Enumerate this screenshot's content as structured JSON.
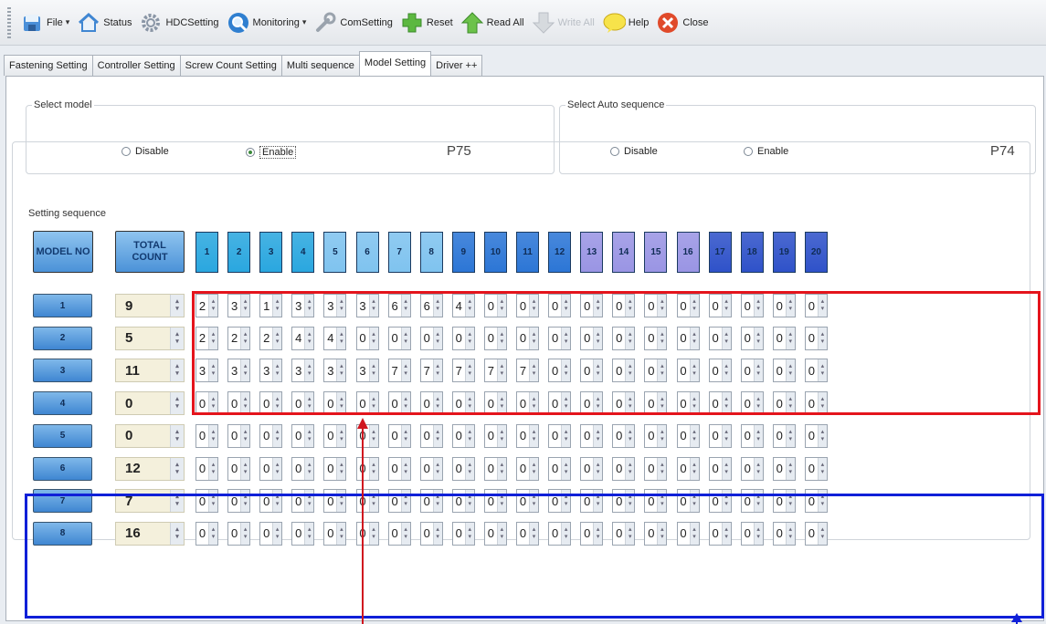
{
  "toolbar": {
    "file": "File",
    "status": "Status",
    "hdc_setting": "HDCSetting",
    "monitoring": "Monitoring",
    "com_setting": "ComSetting",
    "reset": "Reset",
    "read_all": "Read All",
    "write_all": "Write All",
    "help": "Help",
    "close": "Close"
  },
  "tabs": [
    {
      "label": "Fastening Setting",
      "active": false
    },
    {
      "label": "Controller Setting",
      "active": false
    },
    {
      "label": "Screw Count Setting",
      "active": false
    },
    {
      "label": "Multi sequence",
      "active": false
    },
    {
      "label": "Model Setting",
      "active": true
    },
    {
      "label": "Driver ++",
      "active": false
    }
  ],
  "select_model": {
    "legend": "Select model",
    "disable": "Disable",
    "enable": "Enable",
    "selected": "Enable",
    "param": "P75"
  },
  "select_auto": {
    "legend": "Select Auto sequence",
    "disable": "Disable",
    "enable": "Enable",
    "selected": "none",
    "param": "P74"
  },
  "sequence": {
    "legend": "Setting sequence",
    "model_no_header": "MODEL NO",
    "total_count_header": "TOTAL COUNT",
    "columns": [
      "1",
      "2",
      "3",
      "4",
      "5",
      "6",
      "7",
      "8",
      "9",
      "10",
      "11",
      "12",
      "13",
      "14",
      "15",
      "16",
      "17",
      "18",
      "19",
      "20"
    ],
    "column_colors": [
      "#2aa7df",
      "#2aa7df",
      "#2aa7df",
      "#2aa7df",
      "#7fc3ef",
      "#7fc3ef",
      "#7fc3ef",
      "#7fc3ef",
      "#2c76d6",
      "#2c76d6",
      "#2c76d6",
      "#2c76d6",
      "#9a95e4",
      "#9a95e4",
      "#9a95e4",
      "#9a95e4",
      "#2f52c9",
      "#2f52c9",
      "#2f52c9",
      "#2f52c9"
    ],
    "rows": [
      {
        "model": "1",
        "total": "9",
        "values": [
          "2",
          "3",
          "1",
          "3",
          "3",
          "3",
          "6",
          "6",
          "4",
          "0",
          "0",
          "0",
          "0",
          "0",
          "0",
          "0",
          "0",
          "0",
          "0",
          "0"
        ]
      },
      {
        "model": "2",
        "total": "5",
        "values": [
          "2",
          "2",
          "2",
          "4",
          "4",
          "0",
          "0",
          "0",
          "0",
          "0",
          "0",
          "0",
          "0",
          "0",
          "0",
          "0",
          "0",
          "0",
          "0",
          "0"
        ]
      },
      {
        "model": "3",
        "total": "11",
        "values": [
          "3",
          "3",
          "3",
          "3",
          "3",
          "3",
          "7",
          "7",
          "7",
          "7",
          "7",
          "0",
          "0",
          "0",
          "0",
          "0",
          "0",
          "0",
          "0",
          "0"
        ]
      },
      {
        "model": "4",
        "total": "0",
        "values": [
          "0",
          "0",
          "0",
          "0",
          "0",
          "0",
          "0",
          "0",
          "0",
          "0",
          "0",
          "0",
          "0",
          "0",
          "0",
          "0",
          "0",
          "0",
          "0",
          "0"
        ]
      },
      {
        "model": "5",
        "total": "0",
        "values": [
          "0",
          "0",
          "0",
          "0",
          "0",
          "0",
          "0",
          "0",
          "0",
          "0",
          "0",
          "0",
          "0",
          "0",
          "0",
          "0",
          "0",
          "0",
          "0",
          "0"
        ]
      },
      {
        "model": "6",
        "total": "12",
        "values": [
          "0",
          "0",
          "0",
          "0",
          "0",
          "0",
          "0",
          "0",
          "0",
          "0",
          "0",
          "0",
          "0",
          "0",
          "0",
          "0",
          "0",
          "0",
          "0",
          "0"
        ]
      },
      {
        "model": "7",
        "total": "7",
        "values": [
          "0",
          "0",
          "0",
          "0",
          "0",
          "0",
          "0",
          "0",
          "0",
          "0",
          "0",
          "0",
          "0",
          "0",
          "0",
          "0",
          "0",
          "0",
          "0",
          "0"
        ]
      },
      {
        "model": "8",
        "total": "16",
        "values": [
          "0",
          "0",
          "0",
          "0",
          "0",
          "0",
          "0",
          "0",
          "0",
          "0",
          "0",
          "0",
          "0",
          "0",
          "0",
          "0",
          "0",
          "0",
          "0",
          "0"
        ]
      }
    ]
  },
  "colors": {
    "highlight_red": "#e4141c",
    "highlight_blue": "#1020d8"
  }
}
